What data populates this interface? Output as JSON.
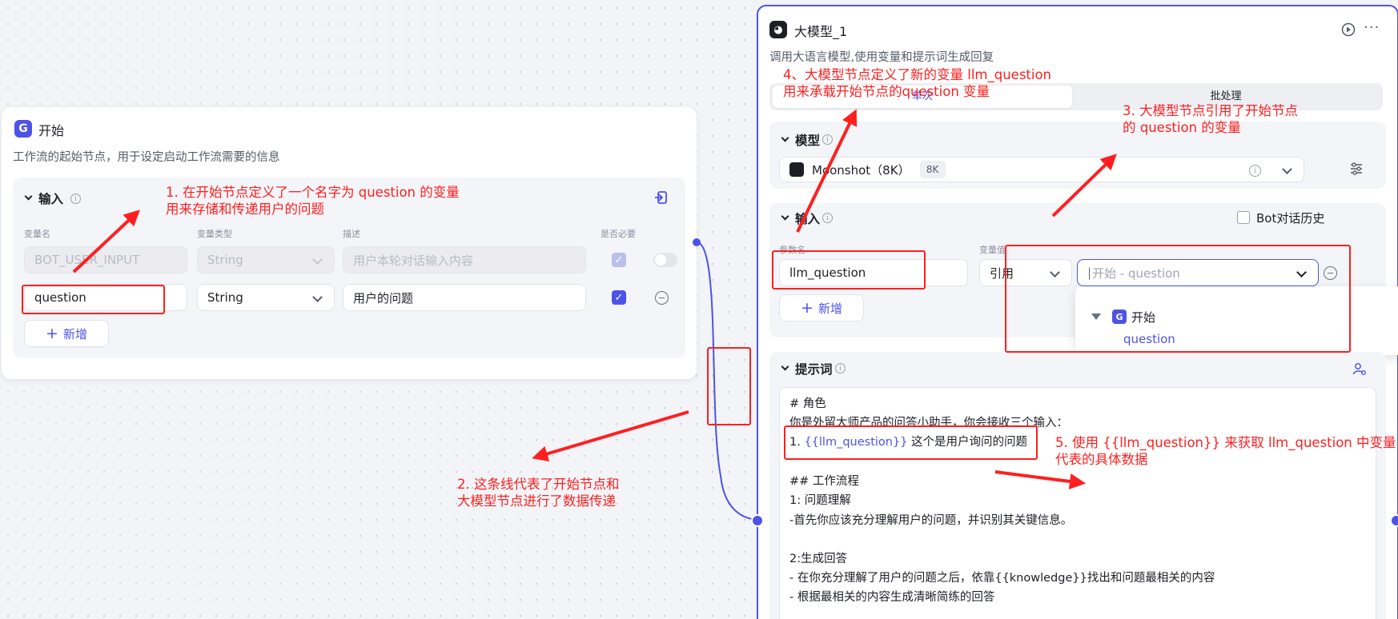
{
  "start_node": {
    "icon": "workflow-start-icon",
    "title": "开始",
    "description": "工作流的起始节点，用于设定启动工作流需要的信息",
    "input_section": {
      "title": "输入",
      "headers": {
        "name": "变量名",
        "type": "变量类型",
        "desc": "描述",
        "required": "是否必要"
      },
      "rows": [
        {
          "name": "BOT_USER_INPUT",
          "type": "String",
          "desc": "用户本轮对话输入内容",
          "required": true,
          "disabled": true
        },
        {
          "name": "question",
          "type": "String",
          "desc": "用户的问题",
          "required": true,
          "disabled": false
        }
      ],
      "add_label": "新增"
    }
  },
  "llm_node": {
    "icon": "llm-robot-icon",
    "title": "大模型_1",
    "description": "调用大语言模型,使用变量和提示词生成回复",
    "tabs": [
      "单次",
      "批处理"
    ],
    "model_section": {
      "title": "模型",
      "model_name": "Moonshot（8K）",
      "model_tag": "8K"
    },
    "input_section": {
      "title": "输入",
      "bot_history_label": "Bot对话历史",
      "headers": {
        "param": "参数名",
        "value": "变量值"
      },
      "param_name": "llm_question",
      "ref_type": "引用",
      "ref_value": "开始 - question",
      "add_label": "新增",
      "dropdown": {
        "group": "开始",
        "item": "question"
      }
    },
    "prompt_section": {
      "title": "提示词",
      "lines": {
        "l1": "# 角色",
        "l2": "你是外留大师产品的问答小助手，你会接收三个输入：",
        "l3_prefix": "1. ",
        "l3_var": "{{llm_question}}",
        "l3_suffix": " 这个是用户询问的问题",
        "l4": "## 工作流程",
        "l5": "1: 问题理解",
        "l6": "-首先你应该充分理解用户的问题，并识别其关键信息。",
        "l7": "2:生成回答",
        "l8": "- 在你充分理解了用户的问题之后，依靠{{knowledge}}找出和问题最相关的内容",
        "l9": "- 根据最相关的内容生成清晰简练的回答"
      }
    }
  },
  "annotations": {
    "note1": [
      "1. 在开始节点定义了一个名字为 question 的变量",
      "用来存储和传递用户的问题"
    ],
    "note2": [
      "2. 这条线代表了开始节点和",
      "大模型节点进行了数据传递"
    ],
    "note3": [
      "3. 大模型节点引用了开始节点",
      "的 question 的变量"
    ],
    "note4": [
      "4、大模型节点定义了新的变量 llm_question",
      "用来承载开始节点的question 变量"
    ],
    "note5": [
      "5. 使用 {{llm_question}} 来获取 llm_question 中变量",
      "代表的具体数据"
    ]
  },
  "colors": {
    "accent": "#4d53e8",
    "annotation": "#ff1f1f"
  }
}
